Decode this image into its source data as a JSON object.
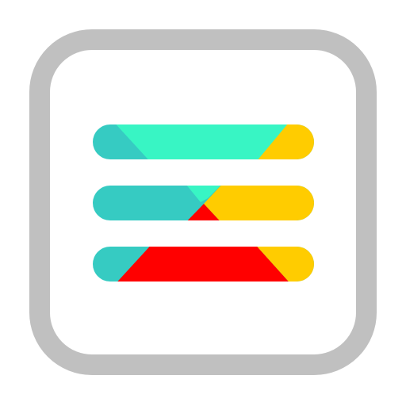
{
  "icon": {
    "name": "menu-icon",
    "colors": {
      "frame": "#c0c0c0",
      "background": "#ffffff",
      "teal_dark": "#36cbc2",
      "teal_light": "#38f5c4",
      "yellow": "#ffcc00",
      "red": "#ff0000"
    }
  }
}
